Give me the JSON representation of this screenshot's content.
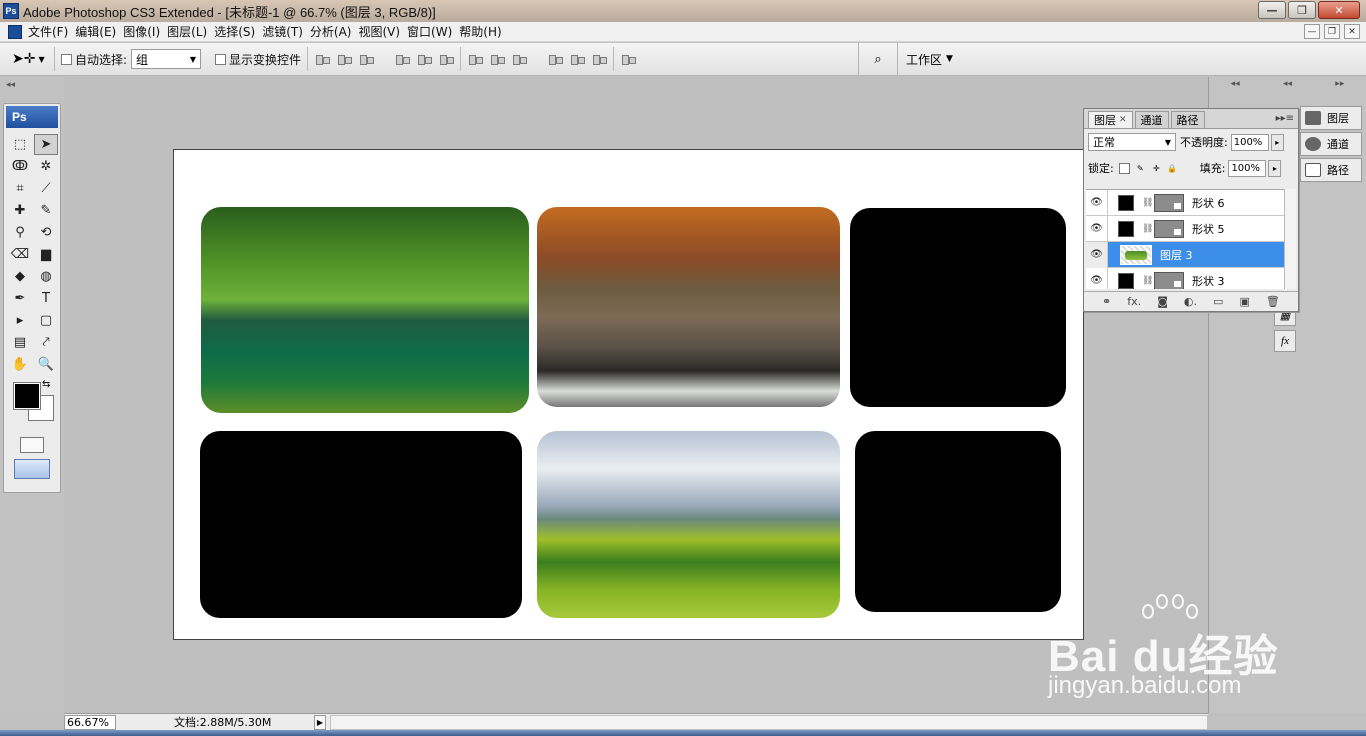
{
  "window": {
    "title": "Adobe Photoshop CS3 Extended - [未标题-1 @ 66.7% (图层 3, RGB/8)]",
    "logo": "Ps",
    "controls": [
      "—",
      "❐",
      "✕"
    ]
  },
  "menubar": {
    "items": [
      "文件(F)",
      "编辑(E)",
      "图像(I)",
      "图层(L)",
      "选择(S)",
      "滤镜(T)",
      "分析(A)",
      "视图(V)",
      "窗口(W)",
      "帮助(H)"
    ],
    "doc_controls": [
      "—",
      "❐",
      "✕"
    ]
  },
  "options": {
    "auto_select_label": "自动选择:",
    "auto_select_value": "组",
    "show_transform_label": "显示变换控件",
    "workspace_label": "工作区"
  },
  "toolbox": {
    "banner": "Ps",
    "tools": [
      {
        "name": "marquee-tool",
        "glyph": "⬚"
      },
      {
        "name": "move-tool",
        "glyph": "➤"
      },
      {
        "name": "lasso-tool",
        "glyph": "ↂ"
      },
      {
        "name": "magic-wand-tool",
        "glyph": "✲"
      },
      {
        "name": "crop-tool",
        "glyph": "⌗"
      },
      {
        "name": "slice-tool",
        "glyph": "⟋"
      },
      {
        "name": "healing-brush-tool",
        "glyph": "✚"
      },
      {
        "name": "brush-tool",
        "glyph": "✎"
      },
      {
        "name": "clone-stamp-tool",
        "glyph": "⚲"
      },
      {
        "name": "history-brush-tool",
        "glyph": "⟲"
      },
      {
        "name": "eraser-tool",
        "glyph": "⌫"
      },
      {
        "name": "gradient-tool",
        "glyph": "▆"
      },
      {
        "name": "blur-tool",
        "glyph": "◆"
      },
      {
        "name": "dodge-tool",
        "glyph": "◍"
      },
      {
        "name": "pen-tool",
        "glyph": "✒"
      },
      {
        "name": "type-tool",
        "glyph": "T"
      },
      {
        "name": "path-selection-tool",
        "glyph": "▸"
      },
      {
        "name": "shape-tool",
        "glyph": "▢"
      },
      {
        "name": "notes-tool",
        "glyph": "▤"
      },
      {
        "name": "eyedropper-tool",
        "glyph": "⤤"
      },
      {
        "name": "hand-tool",
        "glyph": "✋"
      },
      {
        "name": "zoom-tool",
        "glyph": "🔍"
      }
    ]
  },
  "layers_panel": {
    "tabs": [
      "图层",
      "通道",
      "路径"
    ],
    "blend_mode": "正常",
    "opacity_label": "不透明度:",
    "opacity_value": "100%",
    "lock_label": "锁定:",
    "fill_label": "填充:",
    "fill_value": "100%",
    "layers": [
      {
        "name": "形状 6",
        "kind": "shape",
        "selected": false
      },
      {
        "name": "形状 5",
        "kind": "shape",
        "selected": false
      },
      {
        "name": "图层 3",
        "kind": "pixel",
        "selected": true
      },
      {
        "name": "形状 3",
        "kind": "shape",
        "selected": false
      }
    ],
    "footer_icons": [
      "⚭",
      "fx.",
      "◙",
      "◐.",
      "▭",
      "▣",
      "🗑"
    ]
  },
  "dock": {
    "mini_tabs": [
      "图层",
      "通道",
      "路径"
    ],
    "mini_icons": [
      "▦",
      "fx"
    ]
  },
  "status": {
    "zoom": "66.67%",
    "doc_info": "文档:2.88M/5.30M"
  },
  "watermark": {
    "brand": "Bai du经验",
    "url": "jingyan.baidu.com"
  }
}
